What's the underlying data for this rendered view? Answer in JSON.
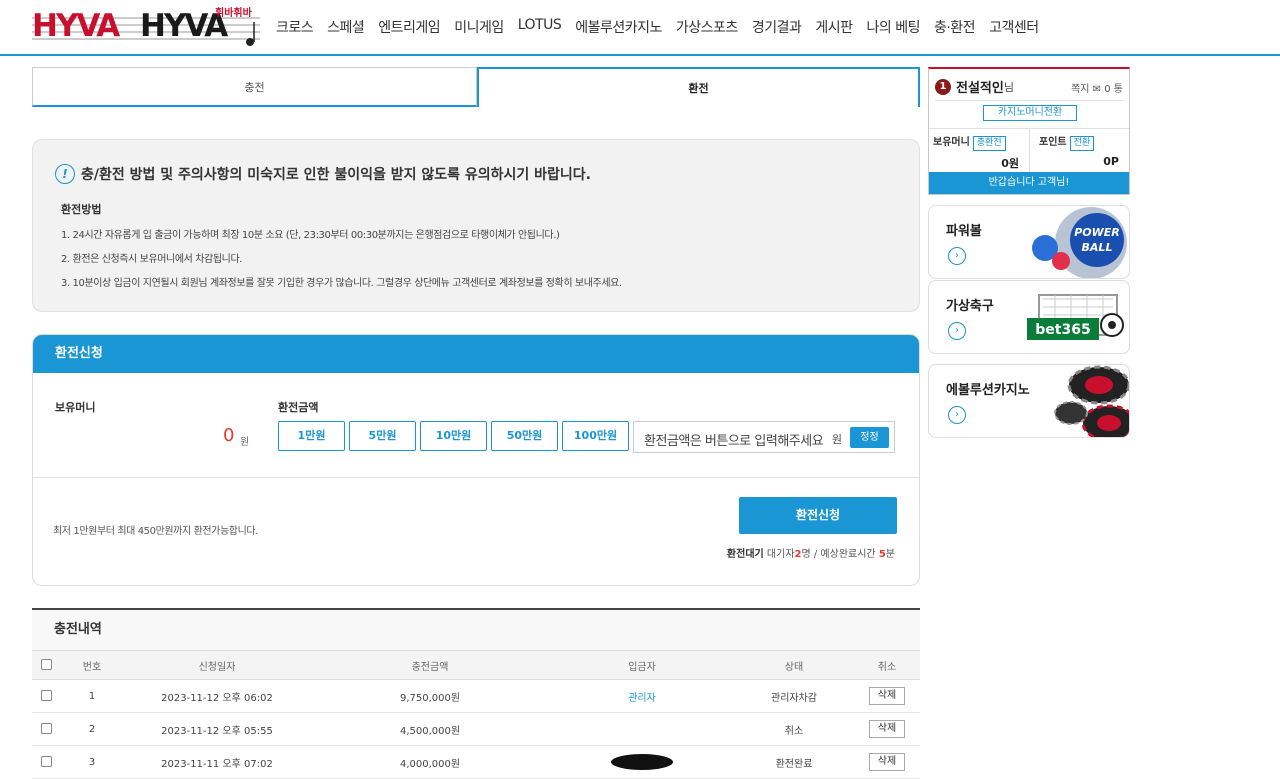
{
  "logo": {
    "text1": "HYVA",
    "text2": "HYVA",
    "sub": "휘바휘바"
  },
  "nav": [
    "크로스",
    "스페셜",
    "엔트리게임",
    "미니게임",
    "LOTUS",
    "에볼루션카지노",
    "가상스포츠",
    "경기결과",
    "게시판",
    "나의 베팅",
    "충·환전",
    "고객센터"
  ],
  "tabs": {
    "charge": "충전",
    "exchange": "환전"
  },
  "notice": {
    "heading": "충/환전 방법 및 주의사항의 미숙지로 인한 불이익을 받지 않도록 유의하시기 바랍니다.",
    "subtitle": "환전방법",
    "lines": [
      "1. 24시간 자유롭게 입 출금이 가능하며 최장 10분 소요 (단, 23:30부터 00:30분까지는 은행점검으로 타행이체가 안됩니다.)",
      "2. 환전은 신청즉시 보유머니에서 차감됩니다.",
      "3. 10분이상 입금이 지연될시 회원님 계좌정보를 잘못 기입한 경우가 많습니다. 그럴경우 상단메뉴 고객센터로 계좌정보를 정확히 보내주세요."
    ]
  },
  "apply": {
    "title": "환전신청",
    "money_label": "보유머니",
    "money_value": "0",
    "money_unit": "원",
    "amount_label": "환전금액",
    "amount_buttons": [
      "1만원",
      "5만원",
      "10만원",
      "50만원",
      "100만원"
    ],
    "input_placeholder": "환전금액은 버튼으로 입력해주세요",
    "input_unit": "원",
    "fix_button": "정정",
    "range_text": "최저 1만원부터 최대 450만원까지 환전가능합니다.",
    "submit": "환전신청",
    "wait_label": "환전대기",
    "wait_prefix": "대기자",
    "wait_count": "2",
    "wait_mid": "명 / 예상완료시간",
    "wait_time": "5",
    "wait_suffix": "분"
  },
  "history": {
    "title": "충전내역",
    "headers": [
      "번호",
      "신청일자",
      "충전금액",
      "입금자",
      "상태",
      "취소"
    ],
    "rows": [
      {
        "no": "1",
        "date": "2023-11-12 오후 06:02",
        "amount": "9,750,000원",
        "depositor": "관리자",
        "status": "관리자차감",
        "cancel": "삭제"
      },
      {
        "no": "2",
        "date": "2023-11-12 오후 05:55",
        "amount": "4,500,000원",
        "depositor": "",
        "status": "취소",
        "cancel": "삭제"
      },
      {
        "no": "3",
        "date": "2023-11-11 오후 07:02",
        "amount": "4,000,000원",
        "depositor": "",
        "status": "환전완료",
        "cancel": "삭제"
      }
    ]
  },
  "user": {
    "badge": "1",
    "name": "전설적인",
    "name_suffix": "님",
    "msg_label": "쪽지",
    "msg_count": "0 통",
    "casino_btn": "카지노머니전환",
    "money_label": "보유머니",
    "money_btn": "충환전",
    "money_value": "0원",
    "point_label": "포인트",
    "point_btn": "전환",
    "point_value": "0P",
    "greeting": "반갑습니다 고객님!"
  },
  "promos": [
    {
      "title": "파워볼",
      "icon": "powerball-icon"
    },
    {
      "title": "가상축구",
      "icon": "bet365-soccer-icon"
    },
    {
      "title": "에볼루션카지노",
      "icon": "casino-chips-icon"
    }
  ],
  "colors": {
    "accent": "#1a96d4",
    "brand_red": "#c8102e",
    "highlight": "#e23b2e"
  }
}
